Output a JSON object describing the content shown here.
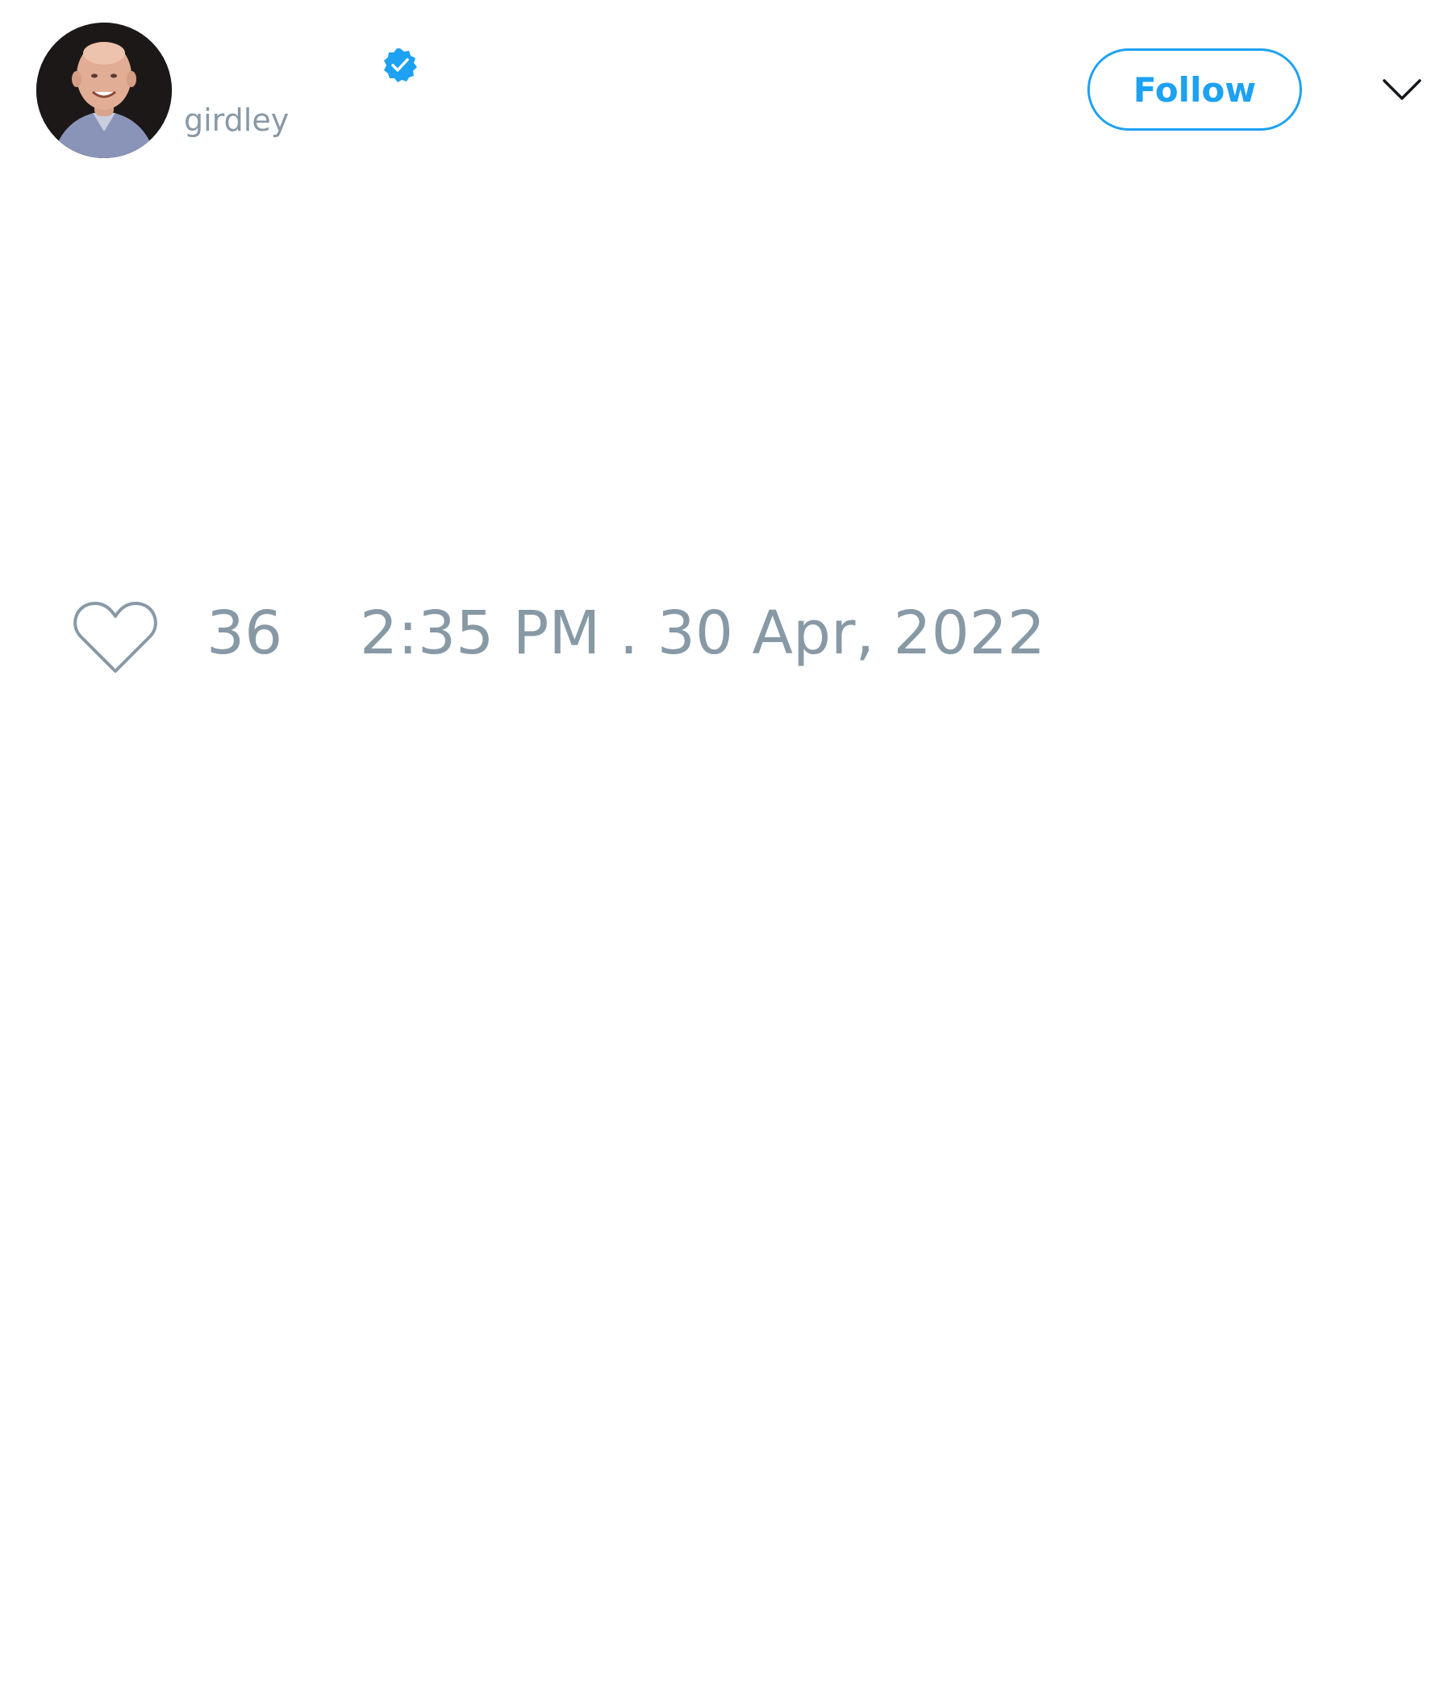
{
  "tweet": {
    "author": {
      "handle": "girdley",
      "avatar": "profile-photo",
      "verified": true,
      "verified_icon": "verified-badge-icon"
    },
    "follow_label": "Follow",
    "menu_icon": "chevron-down-icon",
    "like_icon": "heart-outline-icon",
    "like_count": "36",
    "timestamp": "2:35 PM . 30 Apr, 2022"
  },
  "colors": {
    "accent": "#1da1f2",
    "muted_text": "#8899a6",
    "background": "#ffffff",
    "icon_dark": "#14171a"
  }
}
